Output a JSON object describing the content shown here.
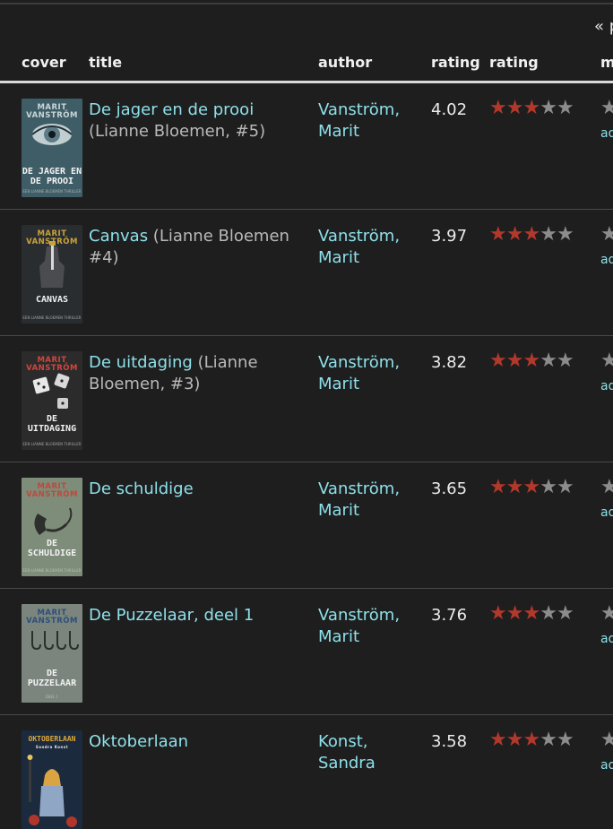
{
  "pager": {
    "label": "« p"
  },
  "headers": {
    "cover": "cover",
    "title": "title",
    "author": "author",
    "avg_rating": "rating",
    "my_rating": "rating",
    "more": "m"
  },
  "colors": {
    "background": "#1e1e1e",
    "link": "#8ee0ea",
    "star_on": "#b2382c",
    "star_off": "#8c8c8c"
  },
  "rows": [
    {
      "title": "De jager en de prooi",
      "series": " (Lianne Bloemen, #5)",
      "author": "Vanström, Marit",
      "rating": "4.02",
      "stars_filled": 3,
      "edge_link": "ad",
      "cover": {
        "author": "MARIT VANSTRÖM",
        "title": "DE JAGER EN DE PROOI",
        "sub": "EEN LIANNE BLOEMEN THRILLER",
        "bg": "#3f5d66",
        "accent": "#c9d6da",
        "icon": "eye-icon"
      }
    },
    {
      "title": "Canvas",
      "series": " (Lianne Bloemen #4)",
      "author": "Vanström, Marit",
      "rating": "3.97",
      "stars_filled": 3,
      "edge_link": "ad",
      "cover": {
        "author": "MARIT VANSTRÖM",
        "title": "CANVAS",
        "sub": "EEN LIANNE BLOEMEN THRILLER",
        "bg": "#2a2d30",
        "accent": "#c9a33a",
        "icon": "hand-icon"
      }
    },
    {
      "title": "De uitdaging",
      "series": " (Lianne Bloemen, #3)",
      "author": "Vanström, Marit",
      "rating": "3.82",
      "stars_filled": 3,
      "edge_link": "ad",
      "cover": {
        "author": "MARIT VANSTRÖM",
        "title": "DE UITDAGING",
        "sub": "EEN LIANNE BLOEMEN THRILLER",
        "bg": "#2b2b2b",
        "accent": "#d2463c",
        "icon": "dice-icon"
      }
    },
    {
      "title": "De schuldige",
      "series": "",
      "author": "Vanström, Marit",
      "rating": "3.65",
      "stars_filled": 3,
      "edge_link": "ad",
      "cover": {
        "author": "MARIT VANSTRÖM",
        "title": "DE SCHULDIGE",
        "sub": "EEN LIANNE BLOEMEN THRILLER",
        "bg": "#7e8c7a",
        "accent": "#c0483a",
        "icon": "phone-icon"
      }
    },
    {
      "title": "De Puzzelaar, deel 1",
      "series": "",
      "author": "Vanström, Marit",
      "rating": "3.76",
      "stars_filled": 3,
      "edge_link": "ad",
      "cover": {
        "author": "MARIT VANSTRÖM",
        "title": "DE PUZZELAAR",
        "sub": "DEEL 1",
        "bg": "#7b857e",
        "accent": "#2e4f78",
        "icon": "hooks-icon"
      }
    },
    {
      "title": "Oktoberlaan",
      "series": "",
      "author": "Konst, Sandra",
      "rating": "3.58",
      "stars_filled": 3,
      "edge_link": "ad",
      "cover": {
        "author": "Sandra Konst",
        "title": "OKTOBERLAAN",
        "sub": "",
        "bg": "#1b2a3d",
        "accent": "#e0a83a",
        "icon": "girl-icon"
      }
    }
  ]
}
